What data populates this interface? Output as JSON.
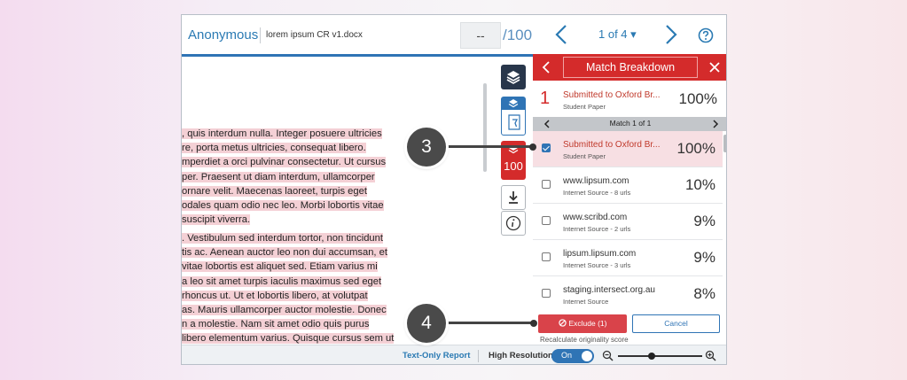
{
  "header": {
    "app_name": "Anonymous",
    "doc_name": "lorem ipsum CR v1.docx",
    "score_value": "--",
    "score_max": "/100",
    "page_indicator": "1 of 4 ▾"
  },
  "document": {
    "paragraph1": [
      ", quis interdum nulla. Integer posuere ultricies",
      "re, porta metus ultricies, consequat libero.",
      "mperdiet a orci pulvinar consectetur. Ut cursus",
      "per. Praesent ut diam interdum, ullamcorper",
      "ornare velit. Maecenas laoreet, turpis eget",
      "odales quam odio nec leo. Morbi lobortis vitae",
      "suscipit viverra."
    ],
    "paragraph2": [
      ". Vestibulum sed interdum tortor, non tincidunt",
      "tis ac. Aenean auctor leo non dui accumsan, et",
      "vitae lobortis est aliquet sed. Etiam varius mi",
      " a leo sit amet turpis iaculis maximus sed eget",
      " rhoncus ut. Ut et lobortis libero, at volutpat",
      "as. Mauris ullamcorper auctor molestie. Donec",
      "n a molestie. Nam sit amet odio quis purus",
      "libero elementum varius. Quisque cursus sem ut"
    ]
  },
  "toolbar": {
    "similarity_score": "100"
  },
  "panel": {
    "title": "Match Breakdown",
    "primary_source": {
      "number": "1",
      "title": "Submitted to Oxford Br...",
      "subtitle": "Student Paper",
      "percent": "100%"
    },
    "match_nav": "Match 1 of 1",
    "sources": [
      {
        "title": "Submitted to Oxford Br...",
        "subtitle": "Student Paper",
        "percent": "100%",
        "checked": true
      },
      {
        "title": "www.lipsum.com",
        "subtitle": "Internet Source - 8 urls",
        "percent": "10%",
        "checked": false
      },
      {
        "title": "www.scribd.com",
        "subtitle": "Internet Source - 2 urls",
        "percent": "9%",
        "checked": false
      },
      {
        "title": "lipsum.lipsum.com",
        "subtitle": "Internet Source - 3 urls",
        "percent": "9%",
        "checked": false
      },
      {
        "title": "staging.intersect.org.au",
        "subtitle": "Internet Source",
        "percent": "8%",
        "checked": false
      }
    ],
    "exclude_label": "Exclude (1)",
    "cancel_label": "Cancel",
    "recalc_note": "Recalculate originality score"
  },
  "footer": {
    "text_only_report": "Text-Only Report",
    "high_resolution": "High Resolution",
    "toggle_state": "On",
    "zoom_level": 0.4
  },
  "callouts": {
    "step3": "3",
    "step4": "4"
  },
  "colors": {
    "brand_blue": "#2f74b5",
    "match_red": "#d42b2b",
    "highlight_pink": "#f4d0d5",
    "navy": "#28364a"
  }
}
